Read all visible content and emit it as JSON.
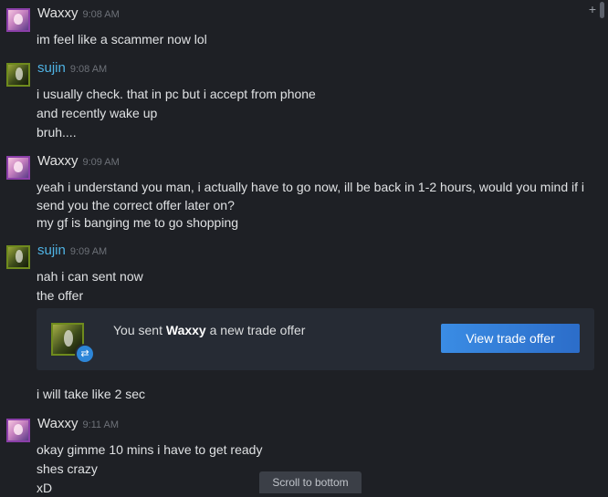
{
  "messages": [
    {
      "user": "Waxxy",
      "time": "9:08 AM",
      "lines": [
        "im feel like a scammer now lol"
      ]
    },
    {
      "user": "sujin",
      "time": "9:08 AM",
      "lines": [
        "i usually check. that in pc but i accept from phone",
        "and recently wake up",
        "bruh...."
      ]
    },
    {
      "user": "Waxxy",
      "time": "9:09 AM",
      "lines": [
        "yeah i understand you man, i actually have to go now, ill be back in 1-2 hours, would you mind if i send you the correct offer later on?",
        "my gf is banging me to go shopping"
      ]
    },
    {
      "user": "sujin",
      "time": "9:09 AM",
      "lines": [
        "nah i can sent now",
        "the offer",
        "i will take like 2 sec"
      ]
    },
    {
      "user": "Waxxy",
      "time": "9:11 AM",
      "lines": [
        "okay gimme 10 mins i have to get ready",
        "shes crazy",
        "xD"
      ]
    }
  ],
  "trade_offer": {
    "prefix": "You sent",
    "recipient": "Waxxy",
    "suffix": "a new trade offer",
    "button_label": "View trade offer"
  },
  "scroll_to_bottom": "Scroll to bottom",
  "colors": {
    "background": "#1e2025",
    "sujin_name": "#4fb3e4",
    "button": "#3a8ce4"
  },
  "icons": {
    "badge": "trade-arrows-icon",
    "corner": "plus-icon"
  }
}
